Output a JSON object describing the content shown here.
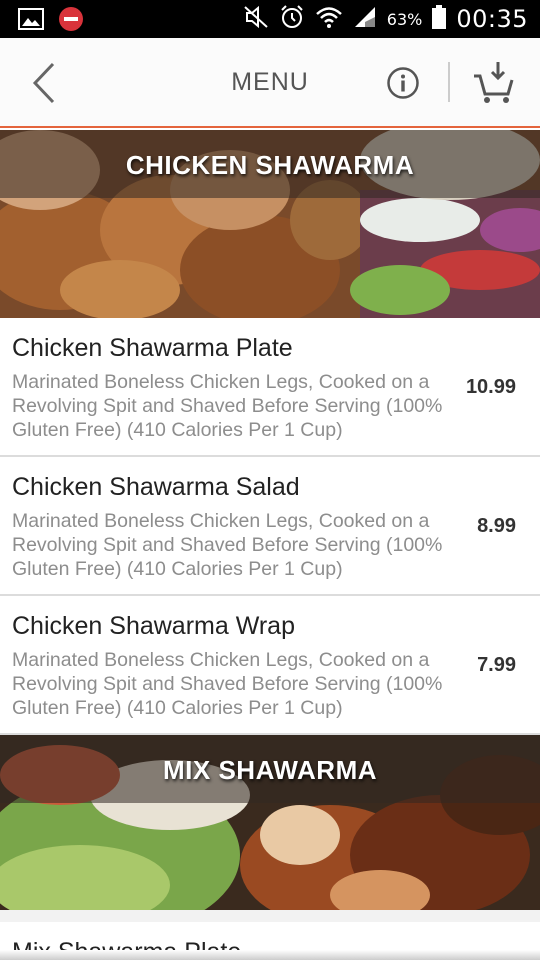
{
  "status_bar": {
    "battery_percent": "63%",
    "time": "00:35",
    "icons": [
      "image-icon",
      "block-icon",
      "mute-icon",
      "alarm-icon",
      "wifi-icon",
      "signal-icon",
      "battery-icon"
    ]
  },
  "header": {
    "title": "MENU",
    "icons": [
      "back-icon",
      "info-icon",
      "cart-icon"
    ],
    "accent_color": "#e4643c"
  },
  "sections": [
    {
      "title": "CHICKEN SHAWARMA",
      "items": [
        {
          "name": "Chicken Shawarma Plate",
          "description": "Marinated Boneless Chicken Legs, Cooked on a Revolving Spit and Shaved Before Serving (100% Gluten Free) (410 Calories Per 1 Cup)",
          "price": "10.99"
        },
        {
          "name": "Chicken Shawarma Salad",
          "description": "Marinated Boneless Chicken Legs, Cooked on a Revolving Spit and Shaved Before Serving (100% Gluten Free) (410 Calories Per 1 Cup)",
          "price": "8.99"
        },
        {
          "name": "Chicken Shawarma Wrap",
          "description": "Marinated Boneless Chicken Legs, Cooked on a Revolving Spit and Shaved Before Serving (100% Gluten Free) (410 Calories Per 1 Cup)",
          "price": "7.99"
        }
      ]
    },
    {
      "title": "MIX SHAWARMA",
      "items": [
        {
          "name": "Mix Shawarma Plate"
        }
      ]
    }
  ]
}
